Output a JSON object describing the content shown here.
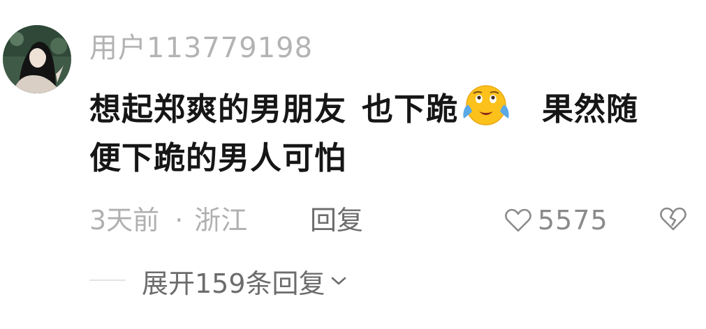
{
  "comment": {
    "username": "用户113779198",
    "content": {
      "line1_part1": "想起郑爽的男朋友",
      "line1_part2": "也下跪",
      "line1_part3": "果然随",
      "line2": "便下跪的男人可怕"
    },
    "emoji": "crying-laughing-face-icon",
    "time": "3天前",
    "separator": "·",
    "location": "浙江",
    "reply_label": "回复",
    "like_count": "5575",
    "expand_label": "展开159条回复"
  },
  "colors": {
    "username": "#b3b3b3",
    "content": "#161616",
    "meta": "#b0b0b0",
    "action": "#6c6c6c",
    "emoji_face": "#fcc21b",
    "emoji_tears": "#5aa9e6"
  }
}
